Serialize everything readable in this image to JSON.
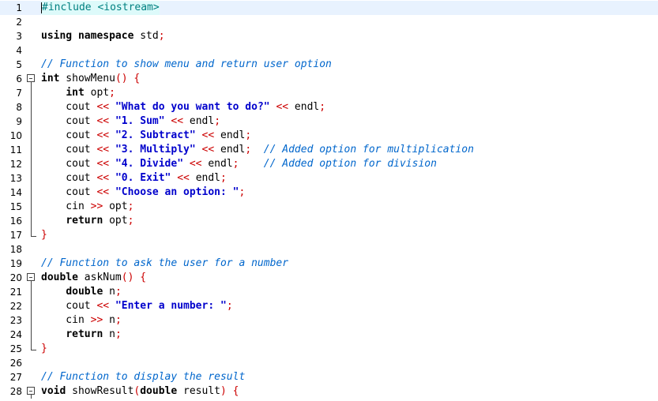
{
  "editor": {
    "colors": {
      "current_line_bg": "#ddfafa",
      "keyword": "#000000",
      "string": "#0000cc",
      "comment": "#0066cc",
      "operator": "#cc0000",
      "preprocessor": "#008080"
    },
    "lines": [
      {
        "n": "1",
        "fold": "none",
        "highlight": true,
        "tokens": [
          {
            "t": "pp",
            "v": "#include <iostream>"
          }
        ]
      },
      {
        "n": "2",
        "fold": "none",
        "tokens": []
      },
      {
        "n": "3",
        "fold": "none",
        "tokens": [
          {
            "t": "kw",
            "v": "using namespace"
          },
          {
            "t": "plain",
            "v": " std"
          },
          {
            "t": "op",
            "v": ";"
          }
        ]
      },
      {
        "n": "4",
        "fold": "none",
        "tokens": []
      },
      {
        "n": "5",
        "fold": "none",
        "tokens": [
          {
            "t": "cmt",
            "v": "// Function to show menu and return user option"
          }
        ]
      },
      {
        "n": "6",
        "fold": "open",
        "tokens": [
          {
            "t": "kw",
            "v": "int"
          },
          {
            "t": "plain",
            "v": " showMenu"
          },
          {
            "t": "op",
            "v": "()"
          },
          {
            "t": "plain",
            "v": " "
          },
          {
            "t": "op",
            "v": "{"
          }
        ]
      },
      {
        "n": "7",
        "fold": "line",
        "tokens": [
          {
            "t": "plain",
            "v": "    "
          },
          {
            "t": "kw",
            "v": "int"
          },
          {
            "t": "plain",
            "v": " opt"
          },
          {
            "t": "op",
            "v": ";"
          }
        ]
      },
      {
        "n": "8",
        "fold": "line",
        "tokens": [
          {
            "t": "plain",
            "v": "    cout "
          },
          {
            "t": "op",
            "v": "<<"
          },
          {
            "t": "plain",
            "v": " "
          },
          {
            "t": "str",
            "v": "\"What do you want to do?\""
          },
          {
            "t": "plain",
            "v": " "
          },
          {
            "t": "op",
            "v": "<<"
          },
          {
            "t": "plain",
            "v": " endl"
          },
          {
            "t": "op",
            "v": ";"
          }
        ]
      },
      {
        "n": "9",
        "fold": "line",
        "tokens": [
          {
            "t": "plain",
            "v": "    cout "
          },
          {
            "t": "op",
            "v": "<<"
          },
          {
            "t": "plain",
            "v": " "
          },
          {
            "t": "str",
            "v": "\"1. Sum\""
          },
          {
            "t": "plain",
            "v": " "
          },
          {
            "t": "op",
            "v": "<<"
          },
          {
            "t": "plain",
            "v": " endl"
          },
          {
            "t": "op",
            "v": ";"
          }
        ]
      },
      {
        "n": "10",
        "fold": "line",
        "tokens": [
          {
            "t": "plain",
            "v": "    cout "
          },
          {
            "t": "op",
            "v": "<<"
          },
          {
            "t": "plain",
            "v": " "
          },
          {
            "t": "str",
            "v": "\"2. Subtract\""
          },
          {
            "t": "plain",
            "v": " "
          },
          {
            "t": "op",
            "v": "<<"
          },
          {
            "t": "plain",
            "v": " endl"
          },
          {
            "t": "op",
            "v": ";"
          }
        ]
      },
      {
        "n": "11",
        "fold": "line",
        "tokens": [
          {
            "t": "plain",
            "v": "    cout "
          },
          {
            "t": "op",
            "v": "<<"
          },
          {
            "t": "plain",
            "v": " "
          },
          {
            "t": "str",
            "v": "\"3. Multiply\""
          },
          {
            "t": "plain",
            "v": " "
          },
          {
            "t": "op",
            "v": "<<"
          },
          {
            "t": "plain",
            "v": " endl"
          },
          {
            "t": "op",
            "v": ";"
          },
          {
            "t": "plain",
            "v": "  "
          },
          {
            "t": "cmt",
            "v": "// Added option for multiplication"
          }
        ]
      },
      {
        "n": "12",
        "fold": "line",
        "tokens": [
          {
            "t": "plain",
            "v": "    cout "
          },
          {
            "t": "op",
            "v": "<<"
          },
          {
            "t": "plain",
            "v": " "
          },
          {
            "t": "str",
            "v": "\"4. Divide\""
          },
          {
            "t": "plain",
            "v": " "
          },
          {
            "t": "op",
            "v": "<<"
          },
          {
            "t": "plain",
            "v": " endl"
          },
          {
            "t": "op",
            "v": ";"
          },
          {
            "t": "plain",
            "v": "    "
          },
          {
            "t": "cmt",
            "v": "// Added option for division"
          }
        ]
      },
      {
        "n": "13",
        "fold": "line",
        "tokens": [
          {
            "t": "plain",
            "v": "    cout "
          },
          {
            "t": "op",
            "v": "<<"
          },
          {
            "t": "plain",
            "v": " "
          },
          {
            "t": "str",
            "v": "\"0. Exit\""
          },
          {
            "t": "plain",
            "v": " "
          },
          {
            "t": "op",
            "v": "<<"
          },
          {
            "t": "plain",
            "v": " endl"
          },
          {
            "t": "op",
            "v": ";"
          }
        ]
      },
      {
        "n": "14",
        "fold": "line",
        "tokens": [
          {
            "t": "plain",
            "v": "    cout "
          },
          {
            "t": "op",
            "v": "<<"
          },
          {
            "t": "plain",
            "v": " "
          },
          {
            "t": "str",
            "v": "\"Choose an option: \""
          },
          {
            "t": "op",
            "v": ";"
          }
        ]
      },
      {
        "n": "15",
        "fold": "line",
        "tokens": [
          {
            "t": "plain",
            "v": "    cin "
          },
          {
            "t": "op",
            "v": ">>"
          },
          {
            "t": "plain",
            "v": " opt"
          },
          {
            "t": "op",
            "v": ";"
          }
        ]
      },
      {
        "n": "16",
        "fold": "line",
        "tokens": [
          {
            "t": "plain",
            "v": "    "
          },
          {
            "t": "kw",
            "v": "return"
          },
          {
            "t": "plain",
            "v": " opt"
          },
          {
            "t": "op",
            "v": ";"
          }
        ]
      },
      {
        "n": "17",
        "fold": "end",
        "tokens": [
          {
            "t": "op",
            "v": "}"
          }
        ]
      },
      {
        "n": "18",
        "fold": "none",
        "tokens": []
      },
      {
        "n": "19",
        "fold": "none",
        "tokens": [
          {
            "t": "cmt",
            "v": "// Function to ask the user for a number"
          }
        ]
      },
      {
        "n": "20",
        "fold": "open",
        "tokens": [
          {
            "t": "kw",
            "v": "double"
          },
          {
            "t": "plain",
            "v": " askNum"
          },
          {
            "t": "op",
            "v": "()"
          },
          {
            "t": "plain",
            "v": " "
          },
          {
            "t": "op",
            "v": "{"
          }
        ]
      },
      {
        "n": "21",
        "fold": "line",
        "tokens": [
          {
            "t": "plain",
            "v": "    "
          },
          {
            "t": "kw",
            "v": "double"
          },
          {
            "t": "plain",
            "v": " n"
          },
          {
            "t": "op",
            "v": ";"
          }
        ]
      },
      {
        "n": "22",
        "fold": "line",
        "tokens": [
          {
            "t": "plain",
            "v": "    cout "
          },
          {
            "t": "op",
            "v": "<<"
          },
          {
            "t": "plain",
            "v": " "
          },
          {
            "t": "str",
            "v": "\"Enter a number: \""
          },
          {
            "t": "op",
            "v": ";"
          }
        ]
      },
      {
        "n": "23",
        "fold": "line",
        "tokens": [
          {
            "t": "plain",
            "v": "    cin "
          },
          {
            "t": "op",
            "v": ">>"
          },
          {
            "t": "plain",
            "v": " n"
          },
          {
            "t": "op",
            "v": ";"
          }
        ]
      },
      {
        "n": "24",
        "fold": "line",
        "tokens": [
          {
            "t": "plain",
            "v": "    "
          },
          {
            "t": "kw",
            "v": "return"
          },
          {
            "t": "plain",
            "v": " n"
          },
          {
            "t": "op",
            "v": ";"
          }
        ]
      },
      {
        "n": "25",
        "fold": "end",
        "tokens": [
          {
            "t": "op",
            "v": "}"
          }
        ]
      },
      {
        "n": "26",
        "fold": "none",
        "tokens": []
      },
      {
        "n": "27",
        "fold": "none",
        "tokens": [
          {
            "t": "cmt",
            "v": "// Function to display the result"
          }
        ]
      },
      {
        "n": "28",
        "fold": "open",
        "tokens": [
          {
            "t": "kw",
            "v": "void"
          },
          {
            "t": "plain",
            "v": " showResult"
          },
          {
            "t": "op",
            "v": "("
          },
          {
            "t": "kw",
            "v": "double"
          },
          {
            "t": "plain",
            "v": " result"
          },
          {
            "t": "op",
            "v": ")"
          },
          {
            "t": "plain",
            "v": " "
          },
          {
            "t": "op",
            "v": "{"
          }
        ]
      }
    ]
  }
}
